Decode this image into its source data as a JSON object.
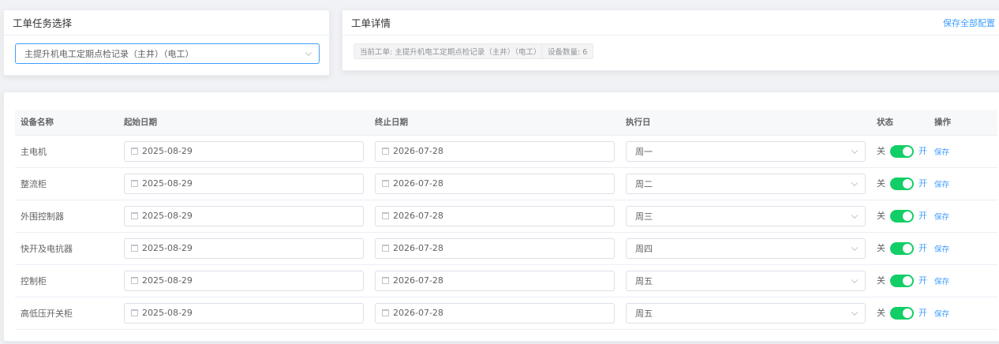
{
  "task_panel": {
    "title": "工单任务选择",
    "selected": "主提升机电工定期点检记录（主井）（电工）"
  },
  "detail_panel": {
    "title": "工单详情",
    "save_all": "保存全部配置",
    "current_tag": "当前工单: 主提升机电工定期点检记录（主井）（电工）",
    "count_tag": "设备数量: 6"
  },
  "table": {
    "headers": [
      "设备名称",
      "起始日期",
      "终止日期",
      "执行日",
      "状态",
      "操作"
    ],
    "rows": [
      {
        "name": "主电机",
        "start": "2025-08-29",
        "end": "2026-07-28",
        "day": "周一",
        "off": "关",
        "on": "开",
        "enabled": true,
        "action": "保存"
      },
      {
        "name": "整流柜",
        "start": "2025-08-29",
        "end": "2026-07-28",
        "day": "周二",
        "off": "关",
        "on": "开",
        "enabled": true,
        "action": "保存"
      },
      {
        "name": "外围控制器",
        "start": "2025-08-29",
        "end": "2026-07-28",
        "day": "周三",
        "off": "关",
        "on": "开",
        "enabled": true,
        "action": "保存"
      },
      {
        "name": "快开及电抗器",
        "start": "2025-08-29",
        "end": "2026-07-28",
        "day": "周四",
        "off": "关",
        "on": "开",
        "enabled": true,
        "action": "保存"
      },
      {
        "name": "控制柜",
        "start": "2025-08-29",
        "end": "2026-07-28",
        "day": "周五",
        "off": "关",
        "on": "开",
        "enabled": true,
        "action": "保存"
      },
      {
        "name": "高低压开关柜",
        "start": "2025-08-29",
        "end": "2026-07-28",
        "day": "周五",
        "off": "关",
        "on": "开",
        "enabled": true,
        "action": "保存"
      }
    ]
  },
  "colors": {
    "accent": "#409eff",
    "toggle_on": "#13ce66"
  }
}
